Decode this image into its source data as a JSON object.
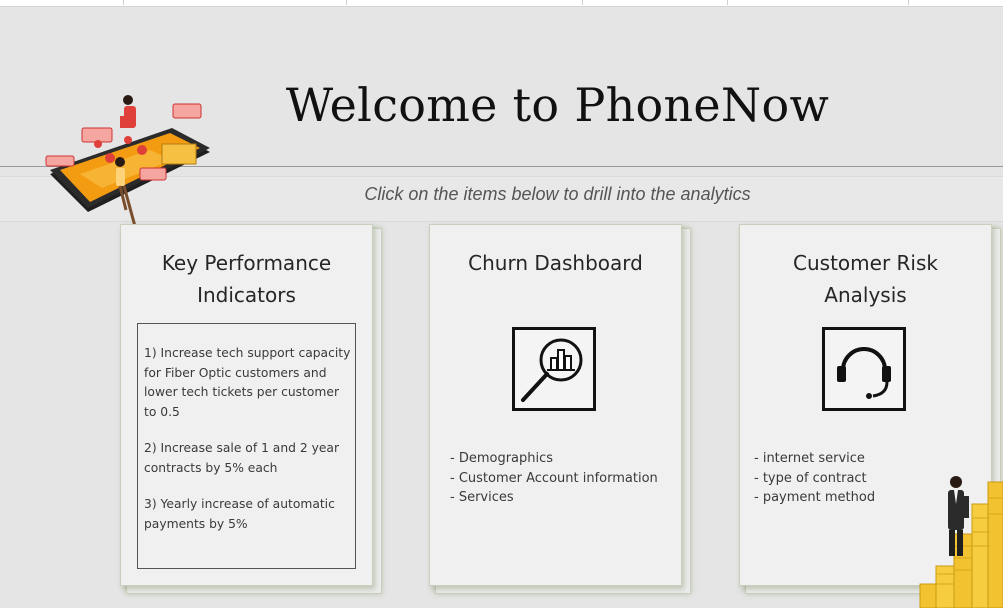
{
  "header": {
    "title": "Welcome to PhoneNow",
    "subtitle": "Click on the items below to drill into the analytics"
  },
  "cards": {
    "kpi": {
      "title_line1": "Key Performance",
      "title_line2": "Indicators",
      "items": [
        "1) Increase tech support capacity for Fiber Optic customers and lower tech tickets per customer to 0.5",
        "2) Increase sale of 1 and 2 year contracts by 5% each",
        "3) Yearly increase of automatic payments by 5%"
      ]
    },
    "churn": {
      "title": "Churn Dashboard",
      "icon": "magnifier-bar-chart-icon",
      "bullets": [
        "Demographics",
        "Customer Account information",
        "Services"
      ]
    },
    "risk": {
      "title_line1": "Customer Risk",
      "title_line2": "Analysis",
      "icon": "headset-icon",
      "bullets": [
        "internet service",
        "type of contract",
        "payment method"
      ]
    }
  },
  "illustrations": {
    "left": "phone-illustration",
    "right": "businessman-coins-illustration"
  },
  "colors": {
    "background": "#e5e5e5",
    "card": "#f0f0f0",
    "card_border": "#c8cfbd",
    "phone_orange": "#f39c12",
    "phone_red": "#e0403a",
    "coin_gold": "#f2c230"
  }
}
